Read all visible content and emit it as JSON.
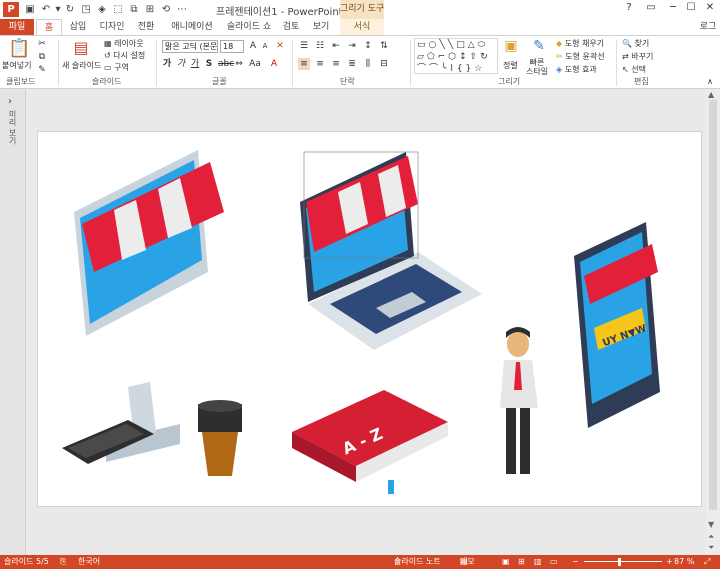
{
  "window": {
    "title": "프레젠테이션1 - PowerPoint",
    "context_tab_group": "그리기 도구",
    "app_icon_label": "P",
    "controls": [
      "?",
      "▭",
      "─",
      "☐",
      "✕"
    ]
  },
  "tabs": [
    {
      "label": "파일"
    },
    {
      "label": "홈"
    },
    {
      "label": "삽입"
    },
    {
      "label": "디자인"
    },
    {
      "label": "전환"
    },
    {
      "label": "애니메이션"
    },
    {
      "label": "슬라이드 쇼"
    },
    {
      "label": "검토"
    },
    {
      "label": "보기"
    },
    {
      "label": "서식"
    }
  ],
  "user_label": "로그",
  "ribbon": {
    "clipboard": {
      "label": "클립보드",
      "paste": "붙여넣기"
    },
    "slides": {
      "label": "슬라이드",
      "new_slide": "새 슬라이드",
      "layout": "레이아웃",
      "reset": "다시 설정",
      "section": "구역"
    },
    "font": {
      "label": "글꼴",
      "font_name": "맑은 고딕 (본문",
      "font_size": "18"
    },
    "paragraph": {
      "label": "단락"
    },
    "drawing": {
      "label": "그리기",
      "arrange": "정렬",
      "quick_styles": "빠른\n스타일",
      "shape_fill": "도형 채우기",
      "shape_outline": "도형 윤곽선",
      "shape_effects": "도형 효과"
    },
    "editing": {
      "label": "편집",
      "find": "찾기",
      "replace": "바꾸기",
      "select": "선택"
    }
  },
  "left_pane": {
    "thumbnail_label": "미리 보기"
  },
  "slide": {
    "tablet_sign": "UY N▼W",
    "book_text": "A - Z"
  },
  "status": {
    "slide_info": "슬라이드 5/5",
    "language": "한국어",
    "notes": "슬라이드 노트",
    "comments": "메모",
    "zoom": "87 %"
  },
  "colors": {
    "accent": "#d24726",
    "awning_red": "#e2203a",
    "screen_blue": "#2aa3e6",
    "monitor_frame": "#3f4e66"
  }
}
